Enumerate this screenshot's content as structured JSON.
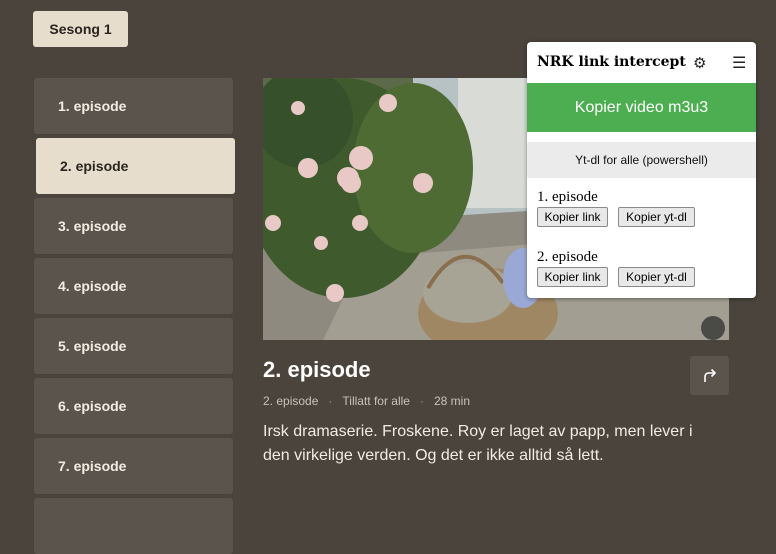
{
  "season": {
    "label": "Sesong 1"
  },
  "episodes": [
    {
      "label": "1. episode",
      "active": false
    },
    {
      "label": "2. episode",
      "active": true
    },
    {
      "label": "3. episode",
      "active": false
    },
    {
      "label": "4. episode",
      "active": false
    },
    {
      "label": "5. episode",
      "active": false
    },
    {
      "label": "6. episode",
      "active": false
    },
    {
      "label": "7. episode",
      "active": false
    },
    {
      "label": "",
      "active": false
    }
  ],
  "detail": {
    "title": "2. episode",
    "meta_episode": "2. episode",
    "meta_rating": "Tillatt for alle",
    "meta_duration": "28 min",
    "description": "Irsk dramaserie. Froskene. Roy er laget av papp, men lever i den virkelige verden. Og det er ikke alltid så lett."
  },
  "popup": {
    "title": "NRK link intercept",
    "settings_icon": "gear-icon",
    "menu_icon": "hamburger-icon",
    "copy_m3u8_label": "Kopier video m3u3",
    "ytdl_all_label": "Yt-dl for alle (powershell)",
    "entries": [
      {
        "label": "1. episode",
        "copy_link": "Kopier link",
        "copy_ytdl": "Kopier yt-dl"
      },
      {
        "label": "2. episode",
        "copy_link": "Kopier link",
        "copy_ytdl": "Kopier yt-dl"
      }
    ]
  },
  "colors": {
    "background": "#4a443d",
    "tile": "#5b544c",
    "accent_cream": "#e7ddcd",
    "popup_green": "#4cae50"
  }
}
